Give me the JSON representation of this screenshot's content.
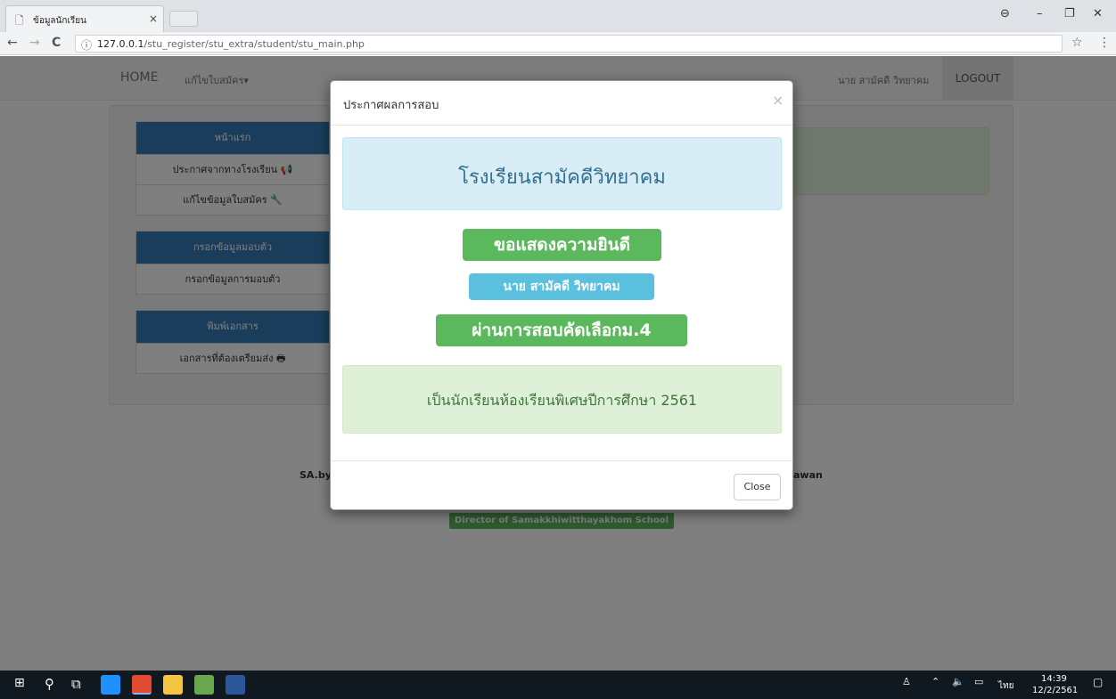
{
  "browser": {
    "tab_title": "ข้อมูลนักเรียน",
    "tab_close": "×",
    "url_host": "127.0.0.1",
    "url_path": "/stu_register/stu_extra/student/stu_main.php",
    "back": "←",
    "forward": "→",
    "reload": "C",
    "info": "ⓘ",
    "star": "☆",
    "menu": "⋮",
    "win_profile": "⊖",
    "win_min": "–",
    "win_max": "❐",
    "win_close": "✕"
  },
  "navbar": {
    "home": "HOME",
    "edit_menu": "แก้ไขใบสมัคร▾",
    "user": "นาย สามัคดี วิทยาคม",
    "logout": "LOGOUT"
  },
  "sidebar": {
    "groups": [
      {
        "title": "หน้าแรก",
        "items": [
          "ประกาศจากทางโรงเรียน 📢",
          "แก้ไขข้อมูลใบสมัคร 🔧"
        ]
      },
      {
        "title": "กรอกข้อมูลมอบตัว",
        "items": [
          "กรอกข้อมูลการมอบตัว"
        ]
      },
      {
        "title": "พิมพ์เอกสาร",
        "items": [
          "เอกสารที่ต้องเตรียมส่ง 🖶"
        ]
      }
    ]
  },
  "footer": {
    "sa_by": "SA.by",
    "right_text": "awan",
    "director_badge": "Director of Samakkhiwitthayakhom School"
  },
  "modal": {
    "title": "ประกาศผลการสอบ",
    "close_x": "×",
    "school_name": "โรงเรียนสามัคคีวิทยาคม",
    "congrats": "ขอแสดงความยินดี",
    "student_name": "นาย สามัคดี วิทยาคม",
    "passed": "ผ่านการสอบคัดเลือกม.4",
    "success_text": "เป็นนักเรียนห้องเรียนพิเศษปีการศึกษา 2561",
    "close_button": "Close"
  },
  "taskbar": {
    "time": "14:39",
    "date": "12/2/2561",
    "lang": "ไทย"
  },
  "colors": {
    "primary": "#337ab7",
    "success": "#5cb85c",
    "info": "#5bc0de"
  }
}
